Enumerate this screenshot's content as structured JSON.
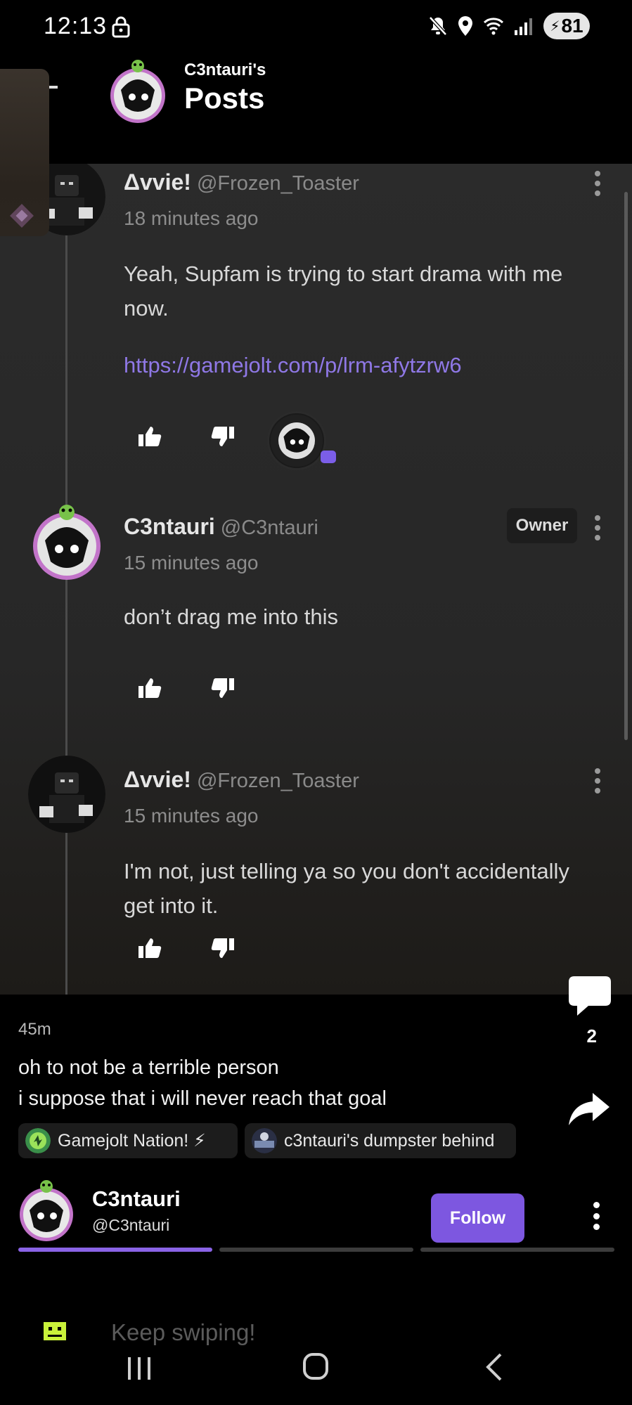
{
  "status_bar": {
    "time": "12:13",
    "battery": "81",
    "icons": [
      "lock-icon",
      "mute-icon",
      "location-icon",
      "wifi-icon",
      "signal-icon",
      "battery-icon"
    ]
  },
  "header": {
    "subtitle": "C3ntauri's",
    "title": "Posts"
  },
  "comments": [
    {
      "name": "Δvvie!",
      "handle": "@Frozen_Toaster",
      "time": "18 minutes ago",
      "body": "Yeah, Supfam is trying to start drama with me now.",
      "link": "https://gamejolt.com/p/lrm-afytzrw6"
    },
    {
      "name": "C3ntauri",
      "handle": "@C3ntauri",
      "time": "15 minutes ago",
      "badge": "Owner",
      "body": "don’t drag me into this"
    },
    {
      "name": "Δvvie!",
      "handle": "@Frozen_Toaster",
      "time": "15 minutes ago",
      "body": "I'm not, just telling ya so you don't accidentally get into it."
    }
  ],
  "post": {
    "age": "45m",
    "line1": "oh to not be a terrible person",
    "line2": "i suppose that i will never reach that goal",
    "comment_count": "2",
    "communities": [
      {
        "label": "Gamejolt Nation! ⚡"
      },
      {
        "label": "c3ntauri's dumpster behind"
      }
    ],
    "author": {
      "name": "C3ntauri",
      "handle": "@C3ntauri",
      "follow_label": "Follow"
    },
    "progress": {
      "segments": 3,
      "active": 1
    }
  },
  "swipe_hint": "Keep swiping!",
  "colors": {
    "accent": "#7d57e0",
    "link": "#8f78e6",
    "background": "#000000",
    "thread_bg": "#2b2b2b"
  }
}
